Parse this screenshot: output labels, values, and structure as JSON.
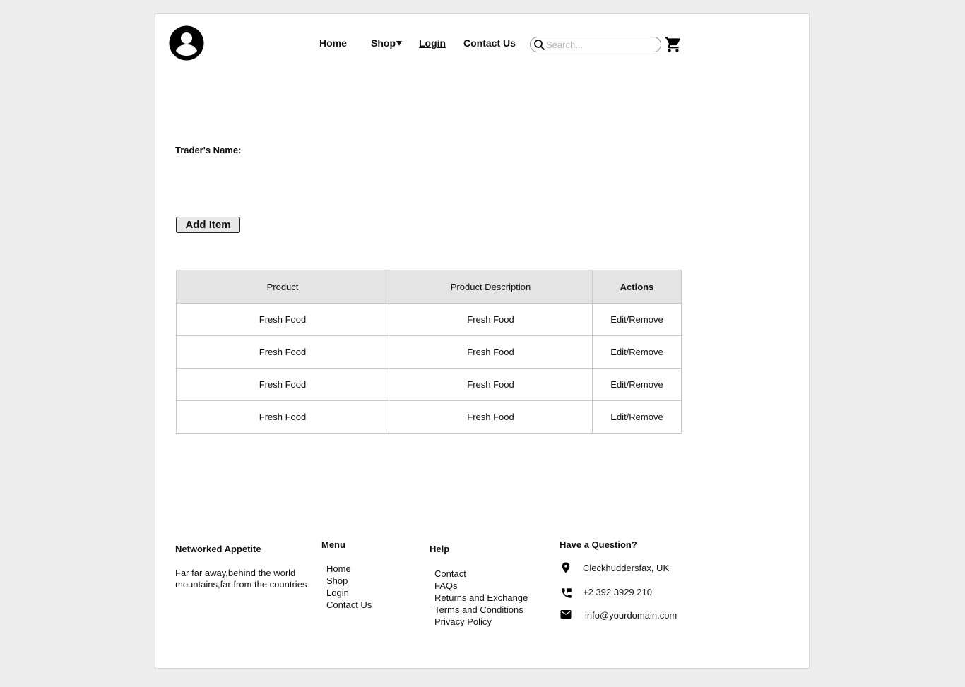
{
  "header": {
    "nav": {
      "home": "Home",
      "shop": "Shop",
      "login": "Login",
      "contact": "Contact Us"
    },
    "search": {
      "placeholder": "Search..."
    },
    "icons": [
      "user-avatar-icon",
      "caret-down-icon",
      "search-icon",
      "cart-icon"
    ]
  },
  "main": {
    "trader_label": "Trader's Name:",
    "add_item_label": "Add Item",
    "table": {
      "headers": [
        "Product",
        "Product Description",
        "Actions"
      ],
      "rows": [
        [
          "Fresh Food",
          "Fresh Food",
          "Edit/Remove"
        ],
        [
          "Fresh Food",
          "Fresh Food",
          "Edit/Remove"
        ],
        [
          "Fresh Food",
          "Fresh Food",
          "Edit/Remove"
        ],
        [
          "Fresh Food",
          "Fresh Food",
          "Edit/Remove"
        ]
      ]
    }
  },
  "footer": {
    "brand": {
      "title": "Networked Appetite",
      "description": "Far far away,behind the world mountains,far from the countries"
    },
    "menu": {
      "title": "Menu",
      "items": [
        "Home",
        "Shop",
        "Login",
        "Contact Us"
      ]
    },
    "help": {
      "title": "Help",
      "items": [
        "Contact",
        "FAQs",
        "Returns and Exchange",
        "Terms and Conditions",
        "Privacy Policy"
      ]
    },
    "question": {
      "title": "Have a Question?",
      "location": "Cleckhuddersfax, UK",
      "phone": "+2 392 3929 210",
      "email": "info@yourdomain.com"
    }
  },
  "colors": {
    "background": "#ededed",
    "page": "#ffffff",
    "table_header": "#e4e4e4",
    "button": "#e8e8e8"
  }
}
